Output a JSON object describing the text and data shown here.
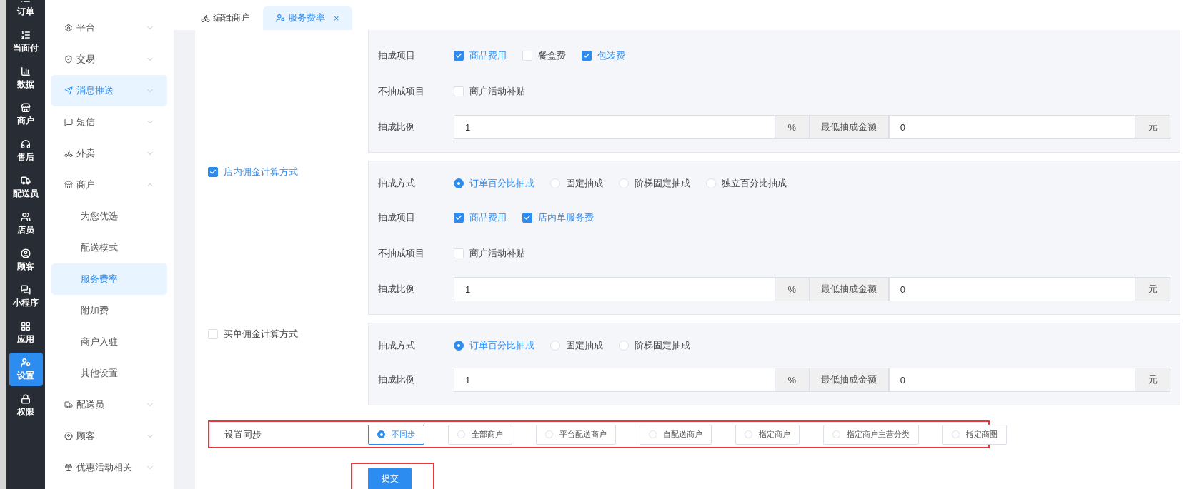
{
  "nav": [
    {
      "label": "订单",
      "selected": false
    },
    {
      "label": "当面付",
      "selected": false
    },
    {
      "label": "数据",
      "selected": false
    },
    {
      "label": "商户",
      "selected": false
    },
    {
      "label": "售后",
      "selected": false
    },
    {
      "label": "配送员",
      "selected": false
    },
    {
      "label": "店员",
      "selected": false
    },
    {
      "label": "顾客",
      "selected": false
    },
    {
      "label": "小程序",
      "selected": false
    },
    {
      "label": "应用",
      "selected": false
    },
    {
      "label": "设置",
      "selected": true
    },
    {
      "label": "权限",
      "selected": false
    }
  ],
  "menu": [
    {
      "label": "平台",
      "expanded": false,
      "selected": false
    },
    {
      "label": "交易",
      "expanded": false,
      "selected": false
    },
    {
      "label": "消息推送",
      "expanded": false,
      "selected": true
    },
    {
      "label": "短信",
      "expanded": false,
      "selected": false
    },
    {
      "label": "外卖",
      "expanded": false,
      "selected": false
    },
    {
      "label": "商户",
      "expanded": true,
      "selected": false,
      "children": [
        {
          "label": "为您优选",
          "selected": false
        },
        {
          "label": "配送模式",
          "selected": false
        },
        {
          "label": "服务费率",
          "selected": true
        },
        {
          "label": "附加费",
          "selected": false
        },
        {
          "label": "商户入驻",
          "selected": false
        },
        {
          "label": "其他设置",
          "selected": false
        }
      ]
    },
    {
      "label": "配送员",
      "expanded": false,
      "selected": false
    },
    {
      "label": "顾客",
      "expanded": false,
      "selected": false
    },
    {
      "label": "优惠活动相关",
      "expanded": false,
      "selected": false
    }
  ],
  "tabs": [
    {
      "label": "编辑商户",
      "selected": false
    },
    {
      "label": "服务费率",
      "selected": true,
      "close": "×"
    }
  ],
  "sections": [
    {
      "rows": [
        {
          "kind": "checks",
          "label": "抽成项目",
          "options": [
            {
              "label": "商品费用",
              "checked": true
            },
            {
              "label": "餐盒费",
              "checked": false
            },
            {
              "label": "包装费",
              "checked": true
            }
          ]
        },
        {
          "kind": "checks",
          "label": "不抽成项目",
          "options": [
            {
              "label": "商户活动补贴",
              "checked": false
            }
          ]
        },
        {
          "kind": "ratio",
          "label": "抽成比例",
          "value": "1",
          "unit": "%",
          "min_label": "最低抽成金额",
          "min_value": "0",
          "min_unit": "元"
        }
      ]
    },
    {
      "title": "店内佣金计算方式",
      "checked": true,
      "rows": [
        {
          "kind": "radios",
          "label": "抽成方式",
          "options": [
            {
              "label": "订单百分比抽成",
              "selected": true
            },
            {
              "label": "固定抽成",
              "selected": false
            },
            {
              "label": "阶梯固定抽成",
              "selected": false
            },
            {
              "label": "独立百分比抽成",
              "selected": false
            }
          ]
        },
        {
          "kind": "checks",
          "label": "抽成项目",
          "options": [
            {
              "label": "商品费用",
              "checked": true
            },
            {
              "label": "店内单服务费",
              "checked": true
            }
          ]
        },
        {
          "kind": "checks",
          "label": "不抽成项目",
          "options": [
            {
              "label": "商户活动补贴",
              "checked": false
            }
          ]
        },
        {
          "kind": "ratio",
          "label": "抽成比例",
          "value": "1",
          "unit": "%",
          "min_label": "最低抽成金额",
          "min_value": "0",
          "min_unit": "元"
        }
      ]
    },
    {
      "title": "买单佣金计算方式",
      "checked": false,
      "rows": [
        {
          "kind": "radios",
          "label": "抽成方式",
          "options": [
            {
              "label": "订单百分比抽成",
              "selected": true
            },
            {
              "label": "固定抽成",
              "selected": false
            },
            {
              "label": "阶梯固定抽成",
              "selected": false
            }
          ]
        },
        {
          "kind": "ratio",
          "label": "抽成比例",
          "value": "1",
          "unit": "%",
          "min_label": "最低抽成金额",
          "min_value": "0",
          "min_unit": "元"
        }
      ]
    }
  ],
  "sync": {
    "label": "设置同步",
    "options": [
      {
        "label": "不同步",
        "selected": true
      },
      {
        "label": "全部商户",
        "selected": false
      },
      {
        "label": "平台配送商户",
        "selected": false
      },
      {
        "label": "自配送商户",
        "selected": false
      },
      {
        "label": "指定商户",
        "selected": false
      },
      {
        "label": "指定商户主营分类",
        "selected": false
      },
      {
        "label": "指定商圈",
        "selected": false
      }
    ]
  },
  "submit": "提交"
}
